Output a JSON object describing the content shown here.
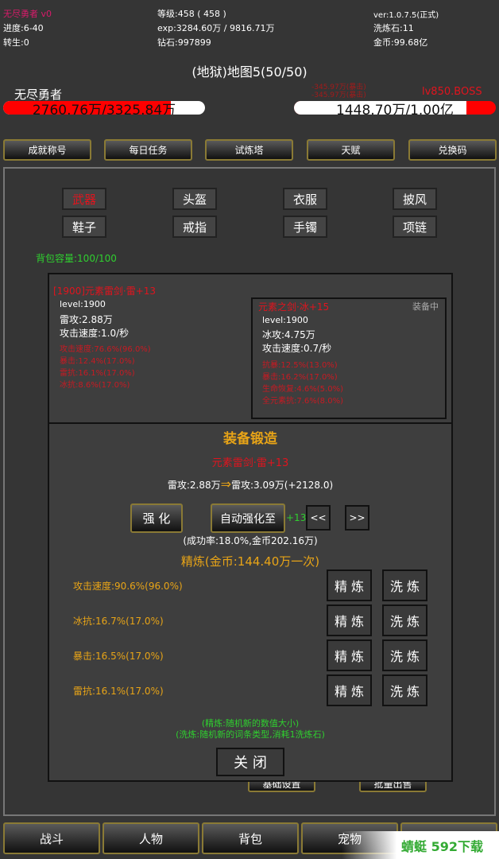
{
  "header": {
    "player_name": "无尽勇者",
    "vip": "v0",
    "progress": "进度:6-40",
    "rebirth": "转生:0",
    "level": "等级:458 ( 458 )",
    "exp": "exp:3284.60万 / 9816.71万",
    "diamonds": "钻石:997899",
    "version": "ver:1.0.7.5(正式)",
    "refine_stones": "洗炼石:11",
    "gold": "金币:99.68亿"
  },
  "battle": {
    "map_title": "(地狱)地图5(50/50)",
    "player_label": "无尽勇者",
    "player_hp": "2760.76万/3325.84万",
    "player_hp_fraction": 0.83,
    "boss_label": "lv850.BOSS",
    "boss_hp": "1448.70万/1.00亿",
    "boss_hp_fraction": 0.145,
    "damage_1": "-345.97万(暴击)",
    "damage_2": "-345.97万(暴击)"
  },
  "top_buttons": [
    "成就称号",
    "每日任务",
    "试炼塔",
    "天赋",
    "兑换码"
  ],
  "categories": [
    "武器",
    "头盔",
    "衣服",
    "披风",
    "鞋子",
    "戒指",
    "手镯",
    "项链"
  ],
  "bag_capacity": "背包容量:100/100",
  "item_new": {
    "name": "[1900]元素雷剑·雷+13",
    "level": "level:1900",
    "attack": "雷攻:2.88万",
    "speed": "攻击速度:1.0/秒",
    "affixes": [
      "攻击速度:76.6%(96.0%)",
      "暴击:12.4%(17.0%)",
      "雷抗:16.1%(17.0%)",
      "冰抗:8.6%(17.0%)"
    ]
  },
  "item_equipped": {
    "name": "元素之剑·冰+15",
    "badge": "装备中",
    "level": "level:1900",
    "attack": "冰攻:4.75万",
    "speed": "攻击速度:0.7/秒",
    "affixes": [
      "抗暴:12.5%(13.0%)",
      "暴击:16.2%(17.0%)",
      "生命恢复:4.6%(5.0%)",
      "全元素抗:7.6%(8.0%)"
    ]
  },
  "forge": {
    "title": "装备锻造",
    "item_name": "元素雷剑·雷+13",
    "compare_before": "雷攻:2.88万",
    "arrow": "⇒",
    "compare_after": "雷攻:3.09万(+2128.0)",
    "enhance": "强 化",
    "auto_enhance": "自动强化至",
    "auto_target": "+13",
    "prev": "<<",
    "next": ">>",
    "cost_info": "(成功率:18.0%,金币202.16万)",
    "refine_title": "精炼(金币:144.40万一次)",
    "refine_rows": [
      {
        "text": "攻击速度:90.6%(96.0%)",
        "refine": "精 炼",
        "reroll": "洗 炼"
      },
      {
        "text": "冰抗:16.7%(17.0%)",
        "refine": "精 炼",
        "reroll": "洗 炼"
      },
      {
        "text": "暴击:16.5%(17.0%)",
        "refine": "精 炼",
        "reroll": "洗 炼"
      },
      {
        "text": "雷抗:16.1%(17.0%)",
        "refine": "精 炼",
        "reroll": "洗 炼"
      }
    ],
    "note1": "(精炼:随机新的数值大小)",
    "note2": "(洗炼:随机新的词条类型,消耗1洗炼石)",
    "close": "关 闭"
  },
  "hidden_buttons": [
    "基础设置",
    "批量出售"
  ],
  "bottom_nav": [
    "战斗",
    "人物",
    "背包",
    "宠物"
  ],
  "watermark": "蜻蜓 592下载",
  "colors": {
    "background": "#353535",
    "red": "#e0141e",
    "gold": "#e8a417",
    "green": "#2fcf2f"
  }
}
